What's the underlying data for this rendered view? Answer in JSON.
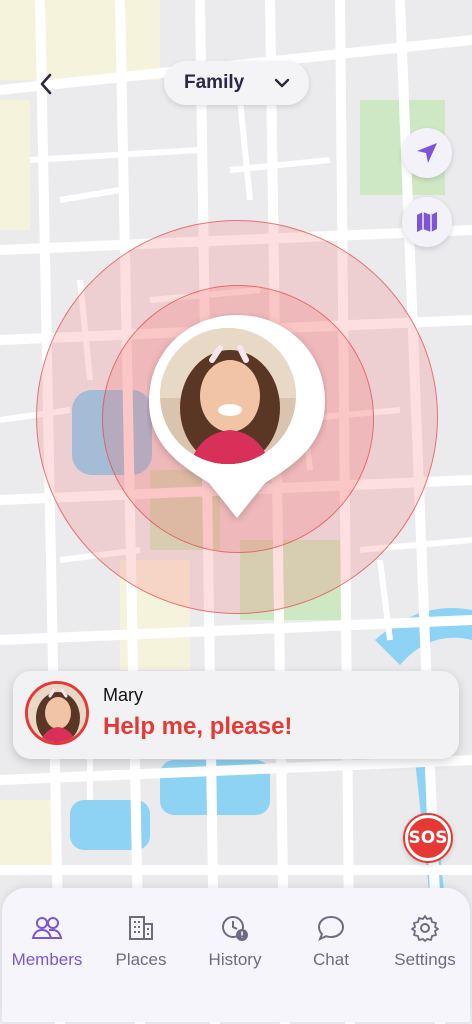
{
  "header": {
    "group_selector": {
      "selected": "Family"
    }
  },
  "member_marker": {
    "member_name": "Mary"
  },
  "alert": {
    "name": "Mary",
    "message": "Help me, please!"
  },
  "sos_button": {
    "label": "SOS"
  },
  "tabs": [
    {
      "label": "Members",
      "icon": "members-icon",
      "active": true
    },
    {
      "label": "Places",
      "icon": "building-icon",
      "active": false
    },
    {
      "label": "History",
      "icon": "history-clock-icon",
      "active": false
    },
    {
      "label": "Chat",
      "icon": "chat-bubble-icon",
      "active": false
    },
    {
      "label": "Settings",
      "icon": "gear-icon",
      "active": false
    }
  ],
  "colors": {
    "accent": "#7b54d9",
    "alert_red": "#e53935",
    "map_road": "#ffffff",
    "map_block": "#e9e9ec",
    "map_park": "#cfe8c4",
    "map_water": "#8fd3f4"
  }
}
